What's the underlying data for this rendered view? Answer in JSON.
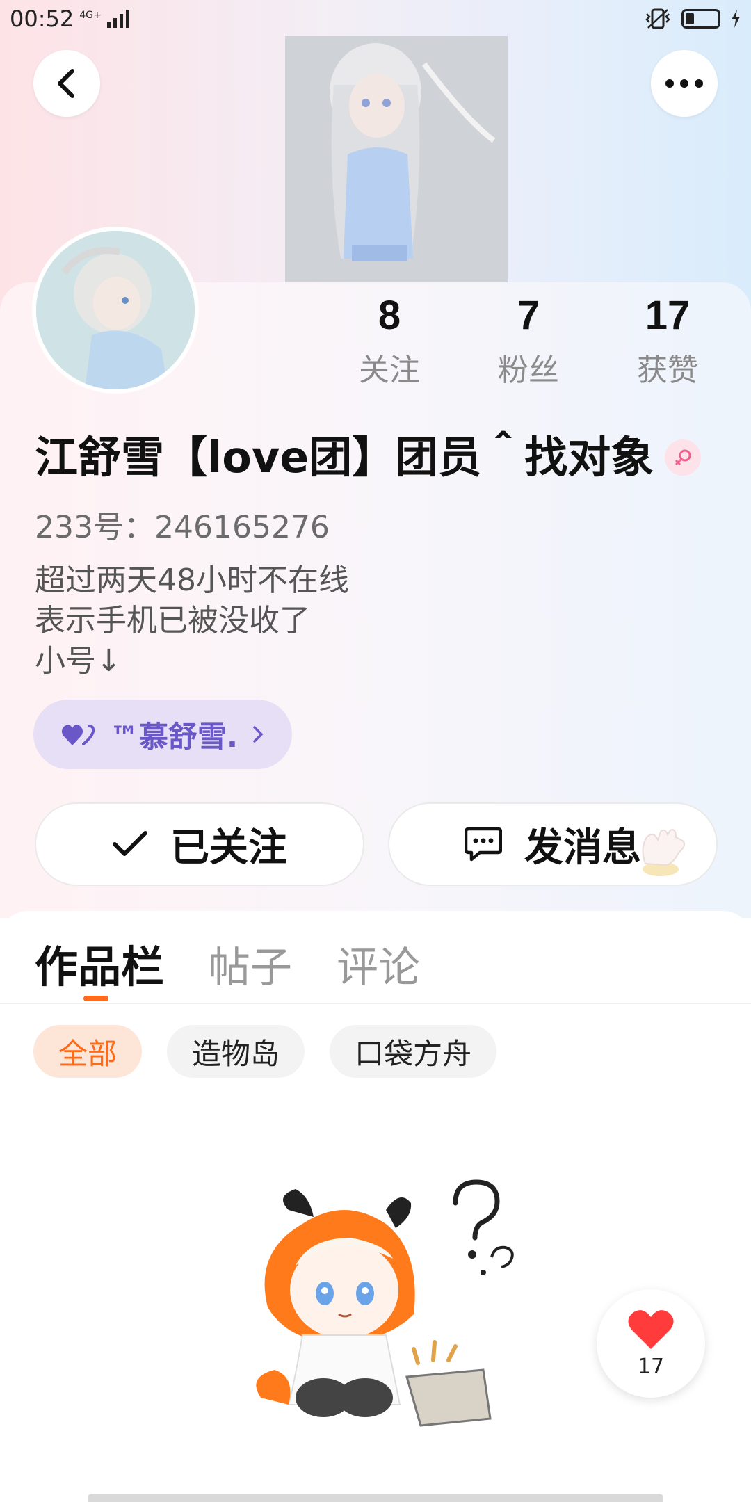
{
  "status_bar": {
    "time": "00:52",
    "network": "4G+"
  },
  "profile": {
    "stats": [
      {
        "value": "8",
        "label": "关注"
      },
      {
        "value": "7",
        "label": "粉丝"
      },
      {
        "value": "17",
        "label": "获赞"
      }
    ],
    "username": "江舒雪【love团】团员＾找对象",
    "uid": "233号：246165276",
    "bio_lines": [
      "超过两天48小时不在线",
      "表示手机已被没收了",
      "小号↓"
    ],
    "linked_account": "™慕舒雪."
  },
  "actions": {
    "follow": "已关注",
    "message": "发消息"
  },
  "tabs": [
    "作品栏",
    "帖子",
    "评论"
  ],
  "chips": [
    "全部",
    "造物岛",
    "口袋方舟"
  ],
  "like_fab": {
    "count": "17"
  },
  "colors": {
    "accent": "#ff6a16",
    "link_purple": "#6a58c9",
    "like_red": "#ff3b3b"
  }
}
